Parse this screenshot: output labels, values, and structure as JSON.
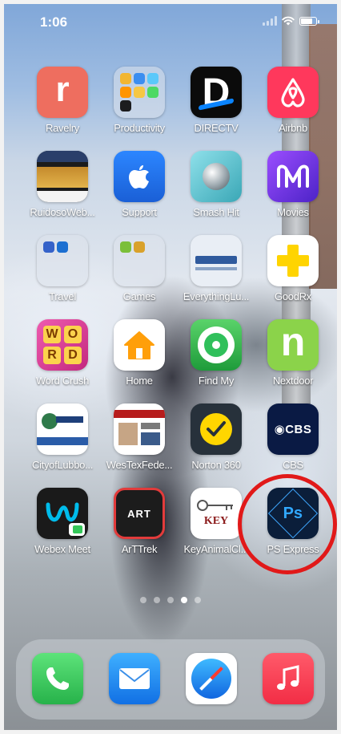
{
  "status_bar": {
    "time": "1:06",
    "battery_level": 0.8
  },
  "apps": [
    {
      "name": "Ravelry",
      "icon": "ravelry-r-icon",
      "glyph": "r",
      "bg": "#ee6e5f"
    },
    {
      "name": "Productivity",
      "icon": "folder-icon",
      "folder": true
    },
    {
      "name": "DIRECTV",
      "icon": "directv-d-icon",
      "glyph": "D",
      "bg": "#0b0b0b"
    },
    {
      "name": "Airbnb",
      "icon": "airbnb-icon",
      "bg": "#ff385c"
    },
    {
      "name": "RuidosoWeb...",
      "icon": "ruidoso-web-icon",
      "bg": "#1b1b1b"
    },
    {
      "name": "Support",
      "icon": "apple-support-icon",
      "glyph": "",
      "bg": "#1f6fe6"
    },
    {
      "name": "Smash Hit",
      "icon": "smash-hit-icon",
      "bg": "#5ec3d0"
    },
    {
      "name": "Movies",
      "icon": "movies-anywhere-icon",
      "bg": "#7a3bd9"
    },
    {
      "name": "Travel",
      "icon": "folder-icon",
      "folder": true
    },
    {
      "name": "Games",
      "icon": "folder-icon",
      "folder": true
    },
    {
      "name": "EverythingLu...",
      "icon": "everything-lubbock-icon",
      "bg": "#e9eef5"
    },
    {
      "name": "GoodRx",
      "icon": "goodrx-icon",
      "bg": "#ffd400"
    },
    {
      "name": "Word Crush",
      "icon": "word-crush-icon",
      "bg": "#e24a9a"
    },
    {
      "name": "Home",
      "icon": "home-icon",
      "bg": "#ffffff"
    },
    {
      "name": "Find My",
      "icon": "find-my-icon",
      "bg": "#2fb84b"
    },
    {
      "name": "Nextdoor",
      "icon": "nextdoor-icon",
      "glyph": "n",
      "bg": "#8bd34a"
    },
    {
      "name": "CityofLubbo...",
      "icon": "city-of-lubbock-icon",
      "bg": "#ffffff"
    },
    {
      "name": "WesTexFede...",
      "icon": "westex-federal-icon",
      "bg": "#ffffff"
    },
    {
      "name": "Norton 360",
      "icon": "norton-check-icon",
      "bg": "#27313b"
    },
    {
      "name": "CBS",
      "icon": "cbs-eye-icon",
      "glyph": "◉CBS",
      "bg": "#0a1a44"
    },
    {
      "name": "Webex Meet",
      "icon": "webex-icon",
      "bg": "#1a1a1a"
    },
    {
      "name": "ArTTrek",
      "icon": "arttrek-icon",
      "glyph": "ART",
      "bg": "#1c1c1c"
    },
    {
      "name": "KeyAnimalCl...",
      "icon": "key-animal-clinic-icon",
      "glyph": "KEY",
      "bg": "#ffffff"
    },
    {
      "name": "PS Express",
      "icon": "ps-express-icon",
      "glyph": "Ps",
      "bg": "#0b1e3a"
    }
  ],
  "page_dots": {
    "count": 5,
    "active": 3
  },
  "dock": [
    {
      "name": "Phone",
      "icon": "phone-icon",
      "bg": "#34c759"
    },
    {
      "name": "Mail",
      "icon": "mail-icon",
      "bg": "#1a8cff"
    },
    {
      "name": "Safari",
      "icon": "safari-compass-icon",
      "bg": "#ffffff"
    },
    {
      "name": "Music",
      "icon": "music-note-icon",
      "bg": "#fa3a4f"
    }
  ],
  "colors": {
    "highlight": "#e11919"
  }
}
